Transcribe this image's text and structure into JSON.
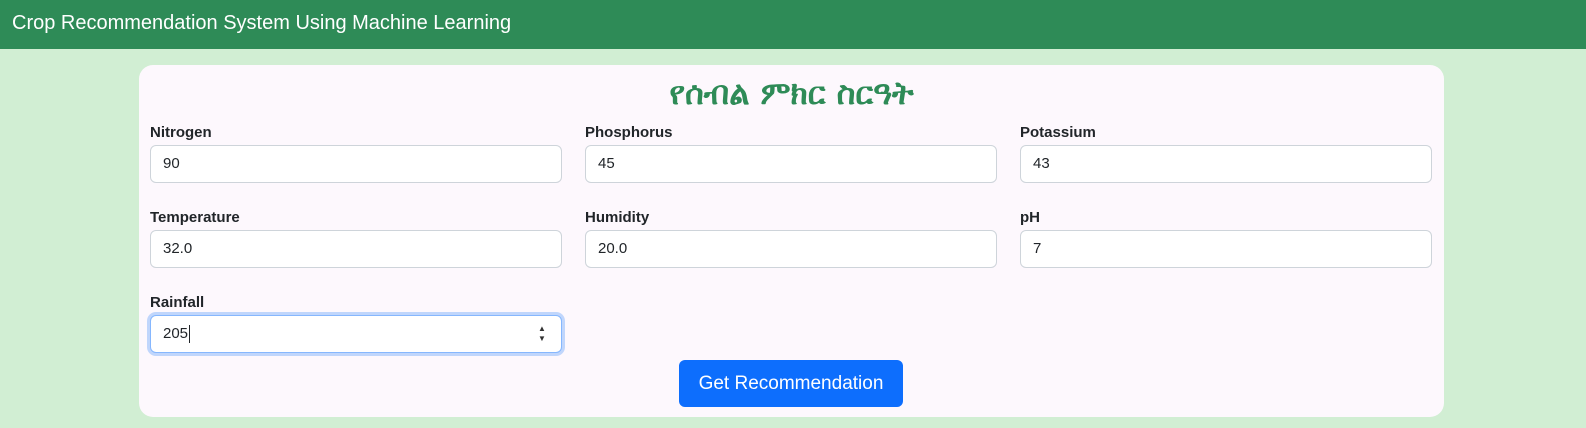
{
  "navbar": {
    "brand": "Crop Recommendation System Using Machine Learning"
  },
  "form": {
    "title": "የሰብል ምክር ስርዓት",
    "fields": [
      {
        "label": "Nitrogen",
        "value": "90"
      },
      {
        "label": "Phosphorus",
        "value": "45"
      },
      {
        "label": "Potassium",
        "value": "43"
      },
      {
        "label": "Temperature",
        "value": "32.0"
      },
      {
        "label": "Humidity",
        "value": "20.0"
      },
      {
        "label": "pH",
        "value": "7"
      },
      {
        "label": "Rainfall",
        "value": "205"
      }
    ],
    "submit_label": "Get Recommendation"
  },
  "colors": {
    "navbar_bg": "#2e8b57",
    "page_bg": "#d1eed3",
    "title": "#2e8b57",
    "button_bg": "#0d6efd"
  },
  "icons": {
    "spinner_up": "spinner-up-icon",
    "spinner_down": "spinner-down-icon"
  }
}
